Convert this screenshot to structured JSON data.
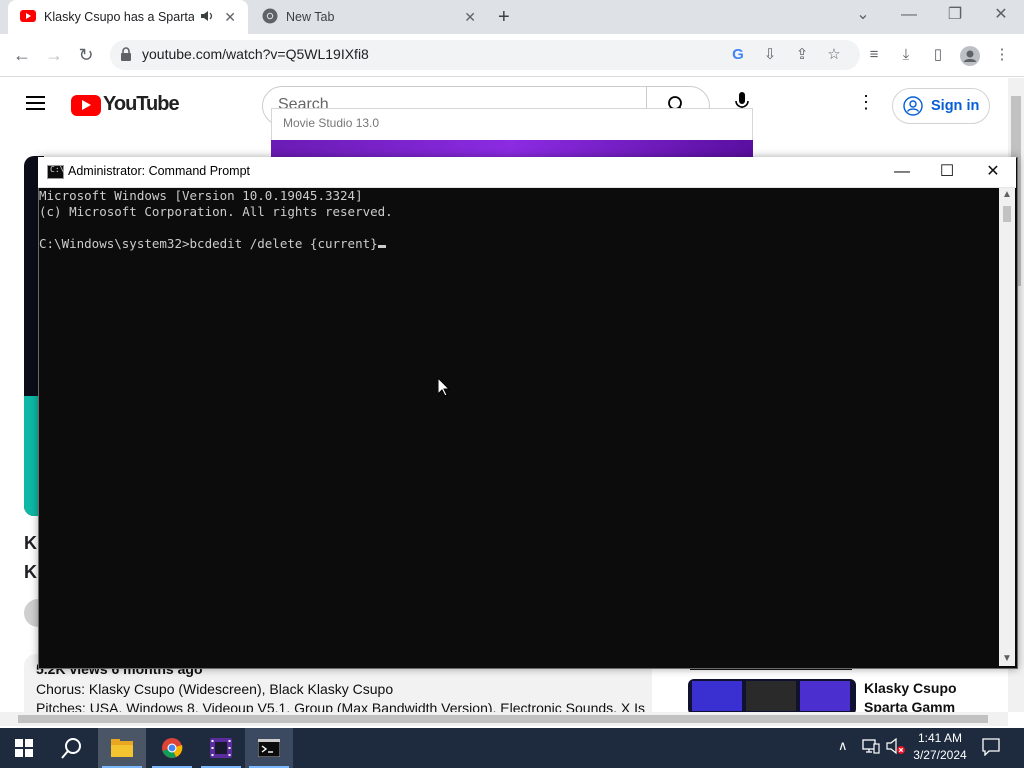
{
  "browser": {
    "tabs": [
      {
        "title": "Klasky Csupo has a Sparta G",
        "active": true,
        "favicon": "youtube-icon",
        "audio_icon": "speaker-icon"
      },
      {
        "title": "New Tab",
        "active": false,
        "favicon": "chrome-icon"
      }
    ],
    "url": "youtube.com/watch?v=Q5WL19IXfi8",
    "toolbar_icons": [
      "google-lens-icon",
      "install-app-icon",
      "share-icon",
      "bookmark-star-icon",
      "media-queue-icon",
      "downloads-icon",
      "side-panel-icon",
      "profile-icon",
      "menu-kebab-icon"
    ]
  },
  "youtube": {
    "logo_text": "YouTube",
    "search_placeholder": "Search",
    "sign_in_label": "Sign in",
    "video_title_line1": "Kl",
    "video_title_line2": "Kl",
    "description": {
      "views": "5.2K views  6 months ago",
      "line1": "Chorus: Klasky Csupo (Widescreen), Black Klasky Csupo",
      "line2": "Pitches: USA, Windows 8, Videoup V5.1, Group (Max Bandwidth Version), Electronic Sounds, X Is"
    },
    "recommendation": {
      "title_line1": "Klasky Csupo",
      "title_line2": "Sparta Gamm"
    }
  },
  "movie_studio": {
    "title": "Movie Studio 13.0"
  },
  "cmd": {
    "window_title": "Administrator: Command Prompt",
    "lines": [
      "Microsoft Windows [Version 10.0.19045.3324]",
      "(c) Microsoft Corporation. All rights reserved.",
      "",
      "C:\\Windows\\system32>bcdedit /delete {current}"
    ]
  },
  "taskbar": {
    "apps": [
      "file-explorer",
      "google-chrome",
      "movie-studio",
      "command-prompt"
    ],
    "clock_time": "1:41 AM",
    "clock_date": "3/27/2024"
  },
  "colors": {
    "youtube_red": "#ff0000",
    "console_bg": "#0c0c0c",
    "console_text": "#cccccc",
    "taskbar_bg": "#1e2a3d",
    "link_blue": "#065fd4"
  }
}
